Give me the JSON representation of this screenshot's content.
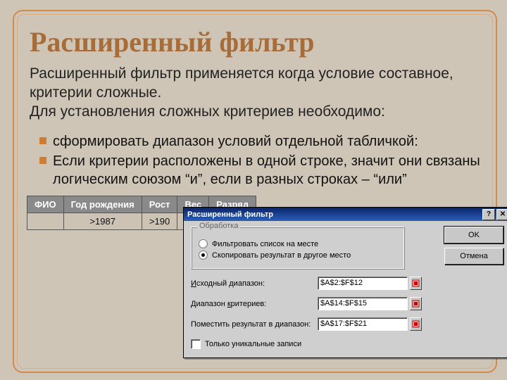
{
  "slide": {
    "title": "Расширенный фильтр",
    "paragraph1": "Расширенный фильтр применяется когда условие составное,  критерии сложные.",
    "paragraph2": "Для установления сложных критериев необходимо:",
    "bullet1": "сформировать диапазон условий  отдельной табличкой:",
    "bullet2": "Если критерии расположены в одной строке, значит они связаны логическим союзом “и”, если в разных строках – “или”"
  },
  "table": {
    "head": {
      "c0": "ФИО",
      "c1": "Год рождения",
      "c2": "Рост",
      "c3": "Вес",
      "c4": "Разряд"
    },
    "row": {
      "c0": "",
      "c1": ">1987",
      "c2": ">190",
      "c3": "",
      "c4": ""
    }
  },
  "dialog": {
    "title": "Расширенный фильтр",
    "help_glyph": "?",
    "close_glyph": "✕",
    "fieldset_legend": "Обработка",
    "radio_inplace": "Фильтровать список на месте",
    "radio_copy": "Скопировать результат в другое место",
    "src_label_u": "И",
    "src_label_rest": "сходный диапазон:",
    "crit_label_rest": "Диапазон ",
    "crit_label_u": "к",
    "crit_label_rest2": "ритериев:",
    "dst_label_rest": "Поместить результат в ",
    "dst_label_u": "д",
    "dst_label_rest2": "иапазон:",
    "src_value": "$A$2:$F$12",
    "crit_value": "$A$14:$F$15",
    "dst_value": "$A$17:$F$21",
    "unique": "Только уникальные записи",
    "ok": "OK",
    "cancel": "Отмена"
  }
}
